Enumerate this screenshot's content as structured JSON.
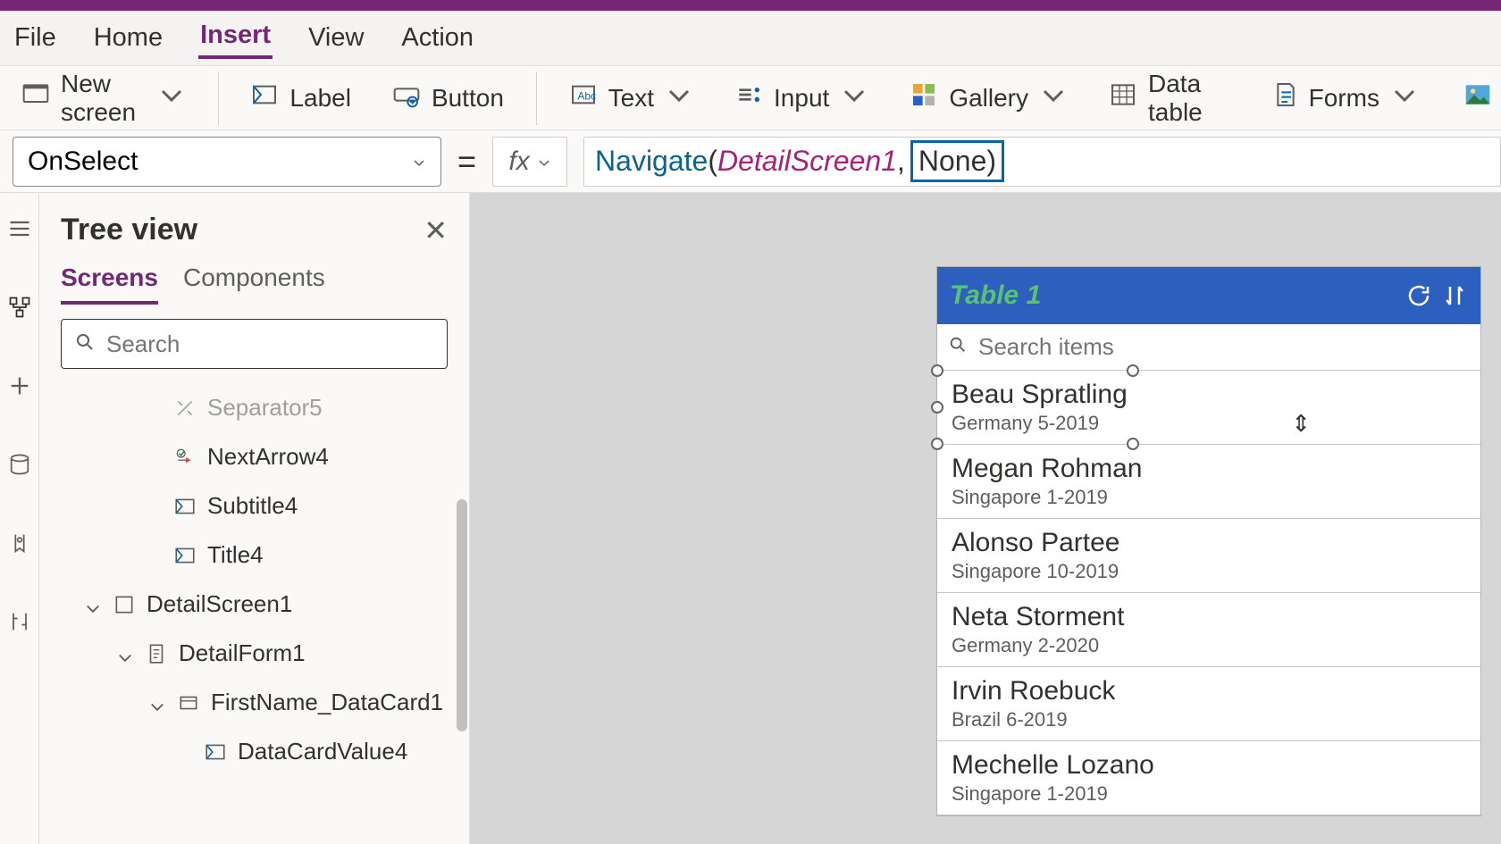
{
  "menu": {
    "file": "File",
    "home": "Home",
    "insert": "Insert",
    "view": "View",
    "action": "Action"
  },
  "ribbon": {
    "new_screen": "New screen",
    "label": "Label",
    "button": "Button",
    "text": "Text",
    "input": "Input",
    "gallery": "Gallery",
    "datatable": "Data table",
    "forms": "Forms"
  },
  "formula": {
    "property": "OnSelect",
    "func": "Navigate",
    "arg1": "DetailScreen1",
    "arg2_hl": "None)",
    "comma": ","
  },
  "tree": {
    "title": "Tree view",
    "tab_screens": "Screens",
    "tab_components": "Components",
    "search_ph": "Search",
    "items": {
      "sep": "Separator5",
      "nextarrow": "NextArrow4",
      "subtitle": "Subtitle4",
      "title4": "Title4",
      "detailscreen": "DetailScreen1",
      "detailform": "DetailForm1",
      "datacard": "FirstName_DataCard1",
      "datacardval": "DataCardValue4"
    }
  },
  "phone": {
    "header": "Table 1",
    "search_ph": "Search items",
    "rows": [
      {
        "title": "Beau Spratling",
        "sub": "Germany 5-2019"
      },
      {
        "title": "Megan Rohman",
        "sub": "Singapore 1-2019"
      },
      {
        "title": "Alonso Partee",
        "sub": "Singapore 10-2019"
      },
      {
        "title": "Neta Storment",
        "sub": "Germany 2-2020"
      },
      {
        "title": "Irvin Roebuck",
        "sub": "Brazil 6-2019"
      },
      {
        "title": "Mechelle Lozano",
        "sub": "Singapore 1-2019"
      }
    ]
  }
}
